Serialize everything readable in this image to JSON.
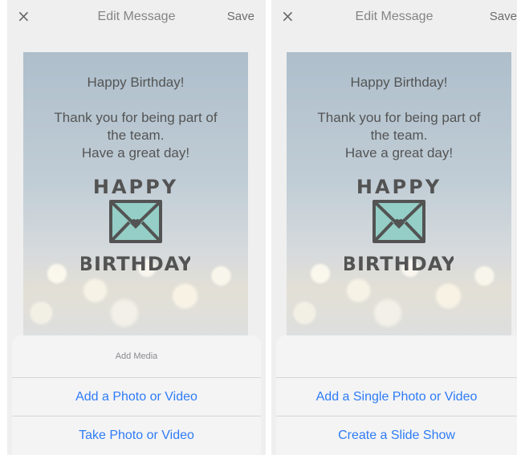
{
  "screens": [
    {
      "nav": {
        "close_icon": "×",
        "title": "Edit Message",
        "save_label": "Save"
      },
      "card": {
        "greeting": "Happy Birthday!",
        "lines": [
          "Thank you for being part of",
          "the team.",
          "Have a great day!"
        ],
        "stamp": {
          "top_word": "HAPPY",
          "bottom_word": "BIRTHDAY",
          "envelope_color": "#6bbcb0"
        }
      },
      "sheet": {
        "heading": "Add Media",
        "options": [
          "Add a Photo or Video",
          "Take Photo or Video"
        ]
      }
    },
    {
      "nav": {
        "close_icon": "×",
        "title": "Edit Message",
        "save_label": "Save"
      },
      "card": {
        "greeting": "Happy Birthday!",
        "lines": [
          "Thank you for being part of",
          "the team.",
          "Have a great day!"
        ],
        "stamp": {
          "top_word": "HAPPY",
          "bottom_word": "BIRTHDAY",
          "envelope_color": "#6bbcb0"
        }
      },
      "sheet": {
        "heading": "",
        "options": [
          "Add a Single Photo or Video",
          "Create a Slide Show"
        ]
      }
    }
  ],
  "colors": {
    "accent": "#2e7cf6",
    "sheet_bg": "#f4f4f5"
  }
}
